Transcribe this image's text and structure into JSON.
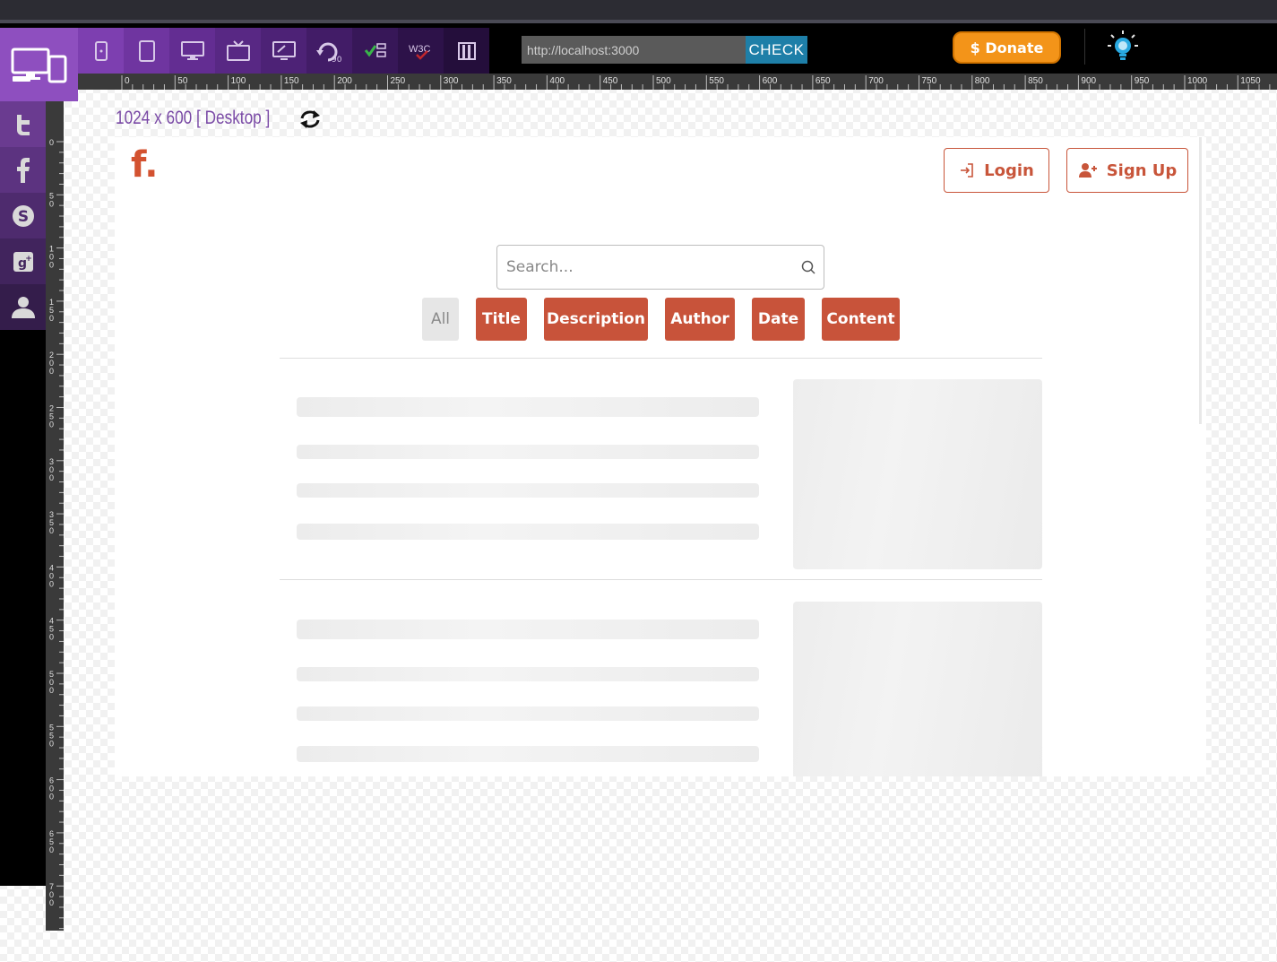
{
  "toolbar": {
    "url_value": "http://localhost:3000",
    "check_label": "CHECK",
    "donate_label": "$ Donate",
    "device_icons": [
      "mobile-icon",
      "tablet-icon",
      "desktop-icon",
      "tv-icon",
      "screen-icon",
      "rotate-90-icon",
      "check-list-icon",
      "w3c-icon",
      "book-icon"
    ]
  },
  "social": [
    "twitter-icon",
    "facebook-icon",
    "skype-icon",
    "google-plus-icon",
    "user-icon"
  ],
  "viewport": {
    "label": "1024 x 600 [ Desktop ]"
  },
  "ruler": {
    "h_ticks": [
      "0",
      "50",
      "100",
      "150",
      "200",
      "250",
      "300",
      "350",
      "400",
      "450",
      "500",
      "550",
      "600",
      "650",
      "700",
      "750",
      "800",
      "850",
      "900",
      "950",
      "1000",
      "1050"
    ],
    "v_ticks": [
      "0",
      "50",
      "100",
      "150",
      "200",
      "250",
      "300",
      "350",
      "400",
      "450",
      "500",
      "550",
      "600",
      "650",
      "700"
    ]
  },
  "site": {
    "brand": "f.",
    "login_label": "Login",
    "signup_label": "Sign Up",
    "search_placeholder": "Search...",
    "filters": [
      {
        "label": "All",
        "active": false
      },
      {
        "label": "Title",
        "active": true
      },
      {
        "label": "Description",
        "active": true
      },
      {
        "label": "Author",
        "active": true
      },
      {
        "label": "Date",
        "active": true
      },
      {
        "label": "Content",
        "active": true
      }
    ]
  },
  "colors": {
    "accent": "#c8533a",
    "tool_purple": "#8e4fbf",
    "donate": "#f39419",
    "check": "#1e7fa8"
  }
}
